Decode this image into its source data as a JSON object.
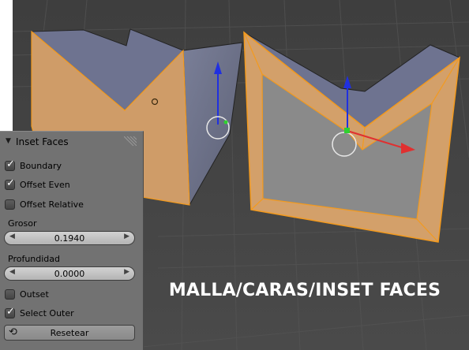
{
  "viewport": {
    "caption": "MALLA/CARAS/INSET FACES",
    "colors": {
      "background": "#424242",
      "selected_face": "#d3a06a",
      "side_face": "#6c7088",
      "edge_highlight": "#f39a1e",
      "axis_x": "#e03030",
      "axis_y": "#2fd12f",
      "axis_z": "#2030e0"
    }
  },
  "panel": {
    "title": "Inset Faces",
    "options": {
      "boundary": {
        "label": "Boundary",
        "checked": true
      },
      "offset_even": {
        "label": "Offset Even",
        "checked": true
      },
      "offset_relative": {
        "label": "Offset Relative",
        "checked": false
      }
    },
    "grosor": {
      "label": "Grosor",
      "value": "0.1940"
    },
    "profundidad": {
      "label": "Profundidad",
      "value": "0.0000"
    },
    "outset": {
      "label": "Outset",
      "checked": false
    },
    "select_outer": {
      "label": "Select Outer",
      "checked": true
    },
    "reset": {
      "label": "Resetear"
    }
  }
}
